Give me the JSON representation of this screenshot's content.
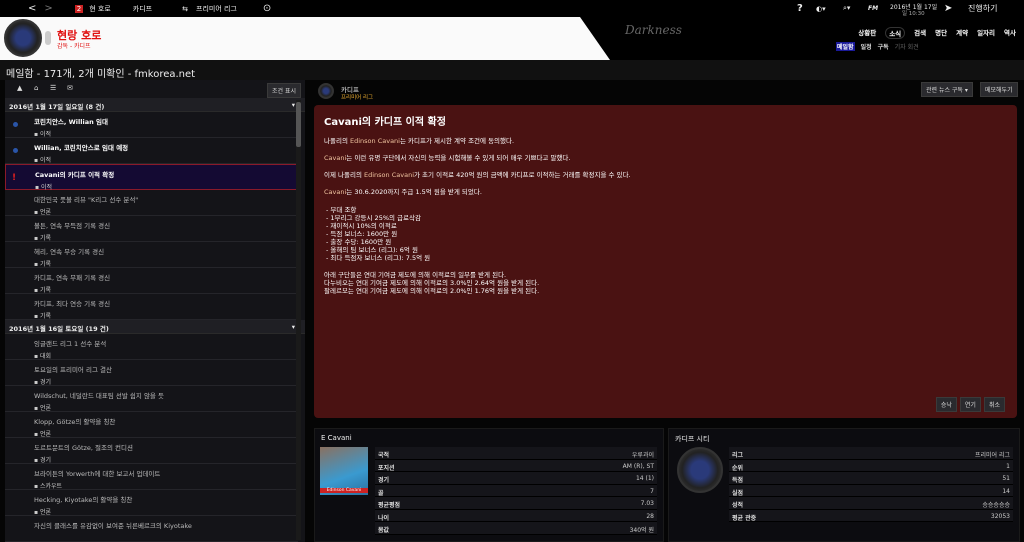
{
  "topbar": {
    "back": "<",
    "forward": ">",
    "badge": "2",
    "manager": "현 호로",
    "club": "카디프",
    "league": "프리미어 리그",
    "date": "2016년 1월 17일",
    "time": "일 10:30",
    "continue": "진행하기",
    "help": "?",
    "fm": "FM"
  },
  "header": {
    "manager_name": "현랑 호로",
    "manager_role": "감독 - 카디프",
    "skin": "Darkness",
    "nav": [
      "상황판",
      "소식",
      "검색",
      "명단",
      "계약",
      "일자리",
      "역사"
    ],
    "active_nav": "소식",
    "subnav": [
      "메일함",
      "일정",
      "구독",
      "기자 회견"
    ],
    "active_subnav": "메일함"
  },
  "page_title": "메일함 - 171개, 2개 미확인 - fmkorea.net",
  "inbox": {
    "filter_button": "조건 표시",
    "groups": [
      {
        "label": "2016년 1월 17일 일요일 (8 건)",
        "items": [
          {
            "title": "코린치안스, Willian 임대",
            "cat": "이적",
            "state": "unread"
          },
          {
            "title": "Willian, 코린치안스로 임대 예정",
            "cat": "이적",
            "state": "unread"
          },
          {
            "title": "Cavani의 카디프 이적 확정",
            "cat": "이적",
            "state": "selected"
          },
          {
            "title": "대한민국 풋볼 리뷰 \"K리그 선수 분석\"",
            "cat": "언론",
            "state": ""
          },
          {
            "title": "볼튼, 연속 무득점 기록 경신",
            "cat": "기록",
            "state": ""
          },
          {
            "title": "헤리, 연속 무승 기록 경신",
            "cat": "기록",
            "state": ""
          },
          {
            "title": "카디프, 연속 무패 기록 경신",
            "cat": "기록",
            "state": ""
          },
          {
            "title": "카디프, 최다 연승 기록 경신",
            "cat": "기록",
            "state": ""
          }
        ]
      },
      {
        "label": "2016년 1월 16일 토요일 (19 건)",
        "items": [
          {
            "title": "잉글랜드 리그 1 선수 분석",
            "cat": "대회",
            "state": ""
          },
          {
            "title": "토요일의 프리미어 리그 결산",
            "cat": "경기",
            "state": ""
          },
          {
            "title": "Wildschut, 네덜란드 대표팀 선발 쉽지 않을 듯",
            "cat": "언론",
            "state": ""
          },
          {
            "title": "Klopp, Götze의 활약을 칭찬",
            "cat": "언론",
            "state": ""
          },
          {
            "title": "도르트문트의 Götze, 절조의 컨디션",
            "cat": "경기",
            "state": ""
          },
          {
            "title": "브라이튼의 Yorwerth에 대한 보고서 업데이트",
            "cat": "스카우트",
            "state": ""
          },
          {
            "title": "Hecking, Kiyotake의 활약을 칭찬",
            "cat": "언론",
            "state": ""
          },
          {
            "title": "자신의 클래스를 유감없이 보여준 뉘른베르크의 Kiyotake",
            "cat": "",
            "state": ""
          }
        ]
      }
    ]
  },
  "message": {
    "sender": "카디프",
    "sender_sub": "프리미어 리그",
    "related_news": "관련 뉴스 구독 ▾",
    "memo": "메모해두기",
    "title": "Cavani의 카디프 이적 확정",
    "p1a": "나폴리의 ",
    "p1b": "Edinson Cavani",
    "p1c": "는 카디프가 제시한 계약 조건에 동의했다.",
    "p2a": "Cavani",
    "p2b": "는 이런 유명 구단에서 자신의 능력을 시험해볼 수 있게 되어 매우 기쁘다고 말했다.",
    "p3a": "이제 나폴리의 ",
    "p3b": "Edinson Cavani",
    "p3c": "가 초기 이적료 420억 원의 금액에 카디프로 이적하는 거래를 확정지을 수 있다.",
    "p4a": "Cavani",
    "p4b": "는 30.6.2020까지 주급 1.5억 원을 받게 되었다.",
    "clauses": [
      "- 부대 조항",
      "- 1부리그 강등시 25%의 급료삭감",
      "- 재이적시 10%의 이적료",
      "- 득점 보너스: 1600만 원",
      "- 출장 수당: 1600만 원",
      "- 올해의 팀 보너스 (리그): 6억 원",
      "- 최다 득점자 보너스 (리그): 7.5억 원"
    ],
    "solidarity": [
      "아래 구단들은 연대 기여금 제도에 의해 이적료의 일부를 받게 된다.",
      "다누비오는 연대 기여금 제도에 의해 이적료의 3.0%인 2.64억 원을 받게 된다.",
      "팔레르모는 연대 기여금 제도에 의해 이적료의 2.0%인 1.76억 원을 받게 된다."
    ],
    "buttons": [
      "승낙",
      "연기",
      "취소"
    ]
  },
  "player": {
    "name": "E Cavani",
    "photo_caption": "Edinson Cavani",
    "rows": [
      [
        "국적",
        "우루과이"
      ],
      [
        "포지션",
        "AM (R), ST"
      ],
      [
        "경기",
        "14 (1)"
      ],
      [
        "골",
        "7"
      ],
      [
        "평균평점",
        "7.03"
      ],
      [
        "나이",
        "28"
      ],
      [
        "몸값",
        "340억 원"
      ]
    ]
  },
  "club": {
    "name": "카디프 시티",
    "rows": [
      [
        "리그",
        "프리미어 리그"
      ],
      [
        "순위",
        "1"
      ],
      [
        "득점",
        "51"
      ],
      [
        "실점",
        "14"
      ],
      [
        "성적",
        "승승승승승"
      ],
      [
        "평균 관중",
        "32053"
      ]
    ]
  },
  "colors": {
    "message_bg": "#4a1212",
    "selected_border": "#8b1a2a",
    "manager_name": "#e01010"
  }
}
